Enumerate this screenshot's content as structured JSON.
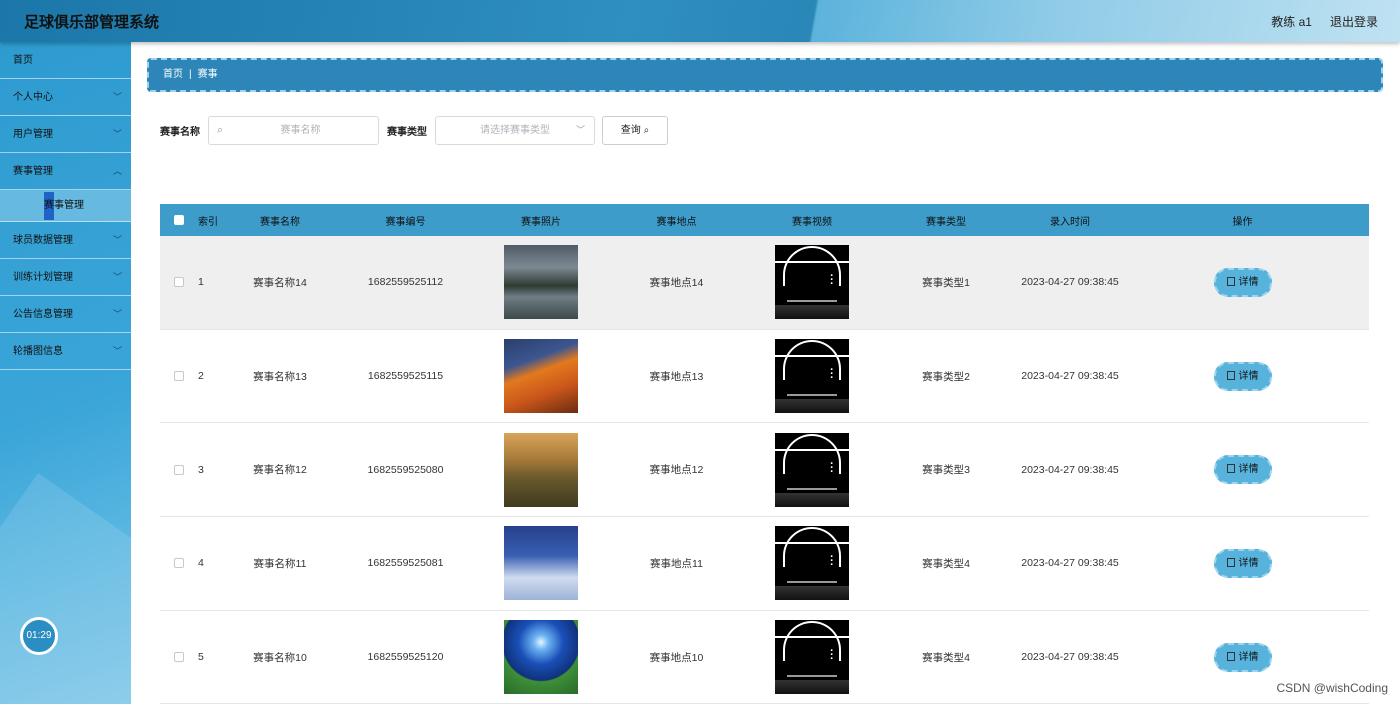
{
  "header": {
    "title": "足球俱乐部管理系统",
    "user": "教练 a1",
    "logout": "退出登录"
  },
  "sidebar": {
    "items": [
      {
        "label": "首页",
        "chev": ""
      },
      {
        "label": "个人中心",
        "chev": "﹀"
      },
      {
        "label": "用户管理",
        "chev": "﹀"
      },
      {
        "label": "赛事管理",
        "chev": "︿"
      },
      {
        "label": "球员数据管理",
        "chev": "﹀"
      },
      {
        "label": "训练计划管理",
        "chev": "﹀"
      },
      {
        "label": "公告信息管理",
        "chev": "﹀"
      },
      {
        "label": "轮播图信息",
        "chev": "﹀"
      }
    ],
    "active_sub": "赛事管理",
    "timer": "01:29"
  },
  "breadcrumb": {
    "home": "首页",
    "sep": "|",
    "current": "赛事"
  },
  "search": {
    "name_label": "赛事名称",
    "name_placeholder": "赛事名称",
    "type_label": "赛事类型",
    "type_placeholder": "请选择赛事类型",
    "button": "查询"
  },
  "table": {
    "columns": [
      "索引",
      "赛事名称",
      "赛事编号",
      "赛事照片",
      "赛事地点",
      "赛事视频",
      "赛事类型",
      "录入时间",
      "操作"
    ],
    "detail_label": "详情",
    "rows": [
      {
        "idx": "1",
        "name": "赛事名称14",
        "no": "1682559525112",
        "loc": "赛事地点14",
        "type": "赛事类型1",
        "time": "2023-04-27 09:38:45",
        "photo": "lake-mountain"
      },
      {
        "idx": "2",
        "name": "赛事名称13",
        "no": "1682559525115",
        "loc": "赛事地点13",
        "type": "赛事类型2",
        "time": "2023-04-27 09:38:45",
        "photo": "orange-mountain"
      },
      {
        "idx": "3",
        "name": "赛事名称12",
        "no": "1682559525080",
        "loc": "赛事地点12",
        "type": "赛事类型3",
        "time": "2023-04-27 09:38:45",
        "photo": "sunset-tree"
      },
      {
        "idx": "4",
        "name": "赛事名称11",
        "no": "1682559525081",
        "loc": "赛事地点11",
        "type": "赛事类型4",
        "time": "2023-04-27 09:38:45",
        "photo": "snow-house"
      },
      {
        "idx": "5",
        "name": "赛事名称10",
        "no": "1682559525120",
        "loc": "赛事地点10",
        "type": "赛事类型4",
        "time": "2023-04-27 09:38:45",
        "photo": "moon-field"
      }
    ]
  },
  "watermark": "CSDN @wishCoding",
  "colors": {
    "header": "#2a87b8",
    "sidebar": "#3aa5d8",
    "table_header": "#3d9cca",
    "accent": "#1f63c6"
  }
}
